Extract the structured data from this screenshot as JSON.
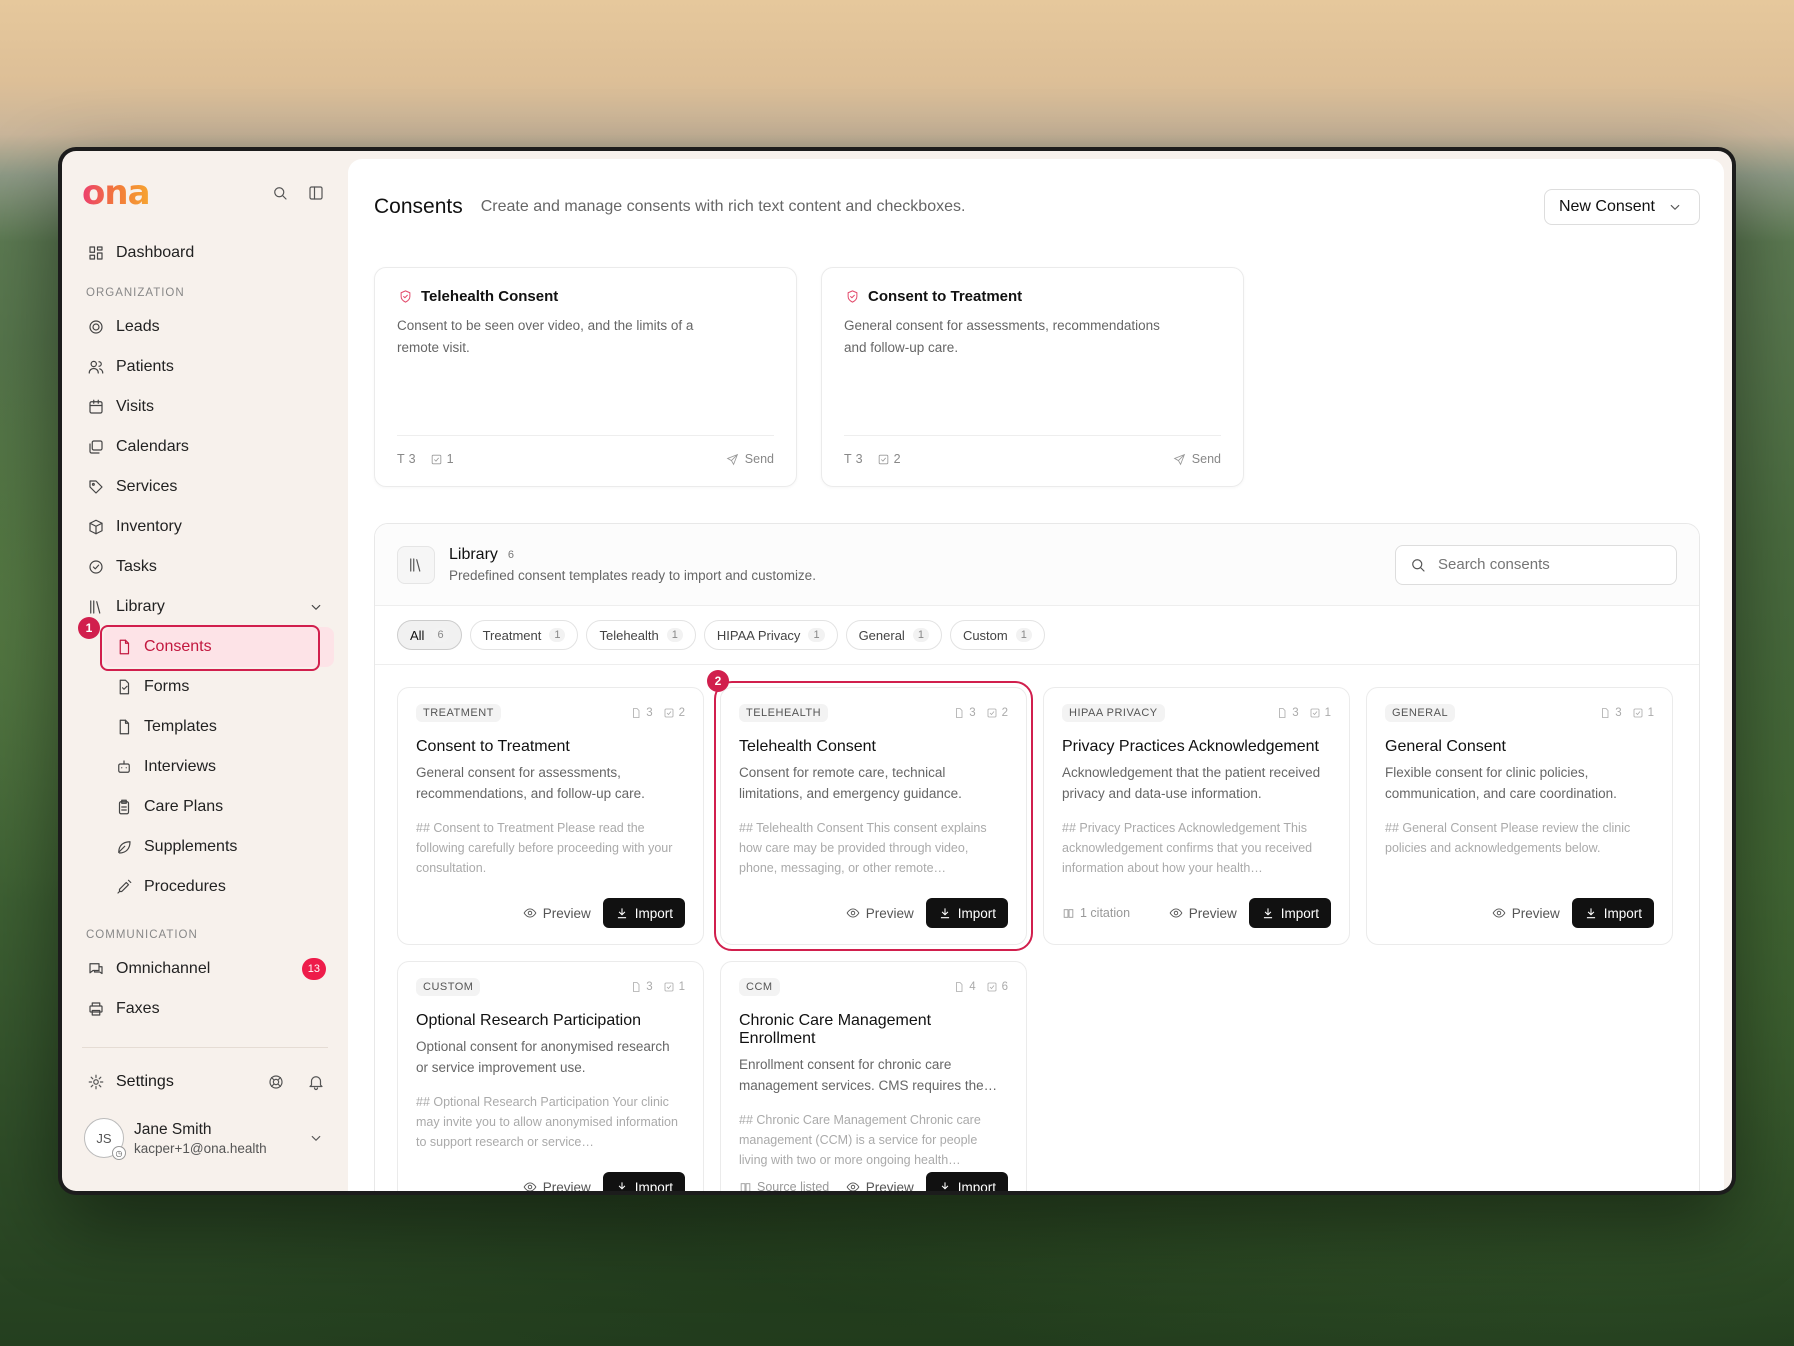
{
  "sidebar": {
    "logo": "ona",
    "dashboard": "Dashboard",
    "org_label": "ORGANIZATION",
    "org_items": [
      "Leads",
      "Patients",
      "Visits",
      "Calendars",
      "Services",
      "Inventory",
      "Tasks"
    ],
    "library": "Library",
    "library_items": [
      "Consents",
      "Forms",
      "Templates",
      "Interviews",
      "Care Plans",
      "Supplements",
      "Procedures"
    ],
    "comm_label": "COMMUNICATION",
    "omnichannel": "Omnichannel",
    "omnichannel_badge": "13",
    "faxes": "Faxes",
    "settings": "Settings",
    "user": {
      "initials": "JS",
      "name": "Jane Smith",
      "email": "kacper+1@ona.health"
    },
    "step1": "1"
  },
  "header": {
    "title": "Consents",
    "description": "Create and manage consents with rich text content and checkboxes.",
    "new_button": "New Consent"
  },
  "top_cards": [
    {
      "title": "Telehealth Consent",
      "body": "Consent to be seen over video, and the limits of a remote visit.",
      "fields": "3",
      "checks": "1",
      "send": "Send"
    },
    {
      "title": "Consent to Treatment",
      "body": "General consent for assessments, recommendations and follow-up care.",
      "fields": "3",
      "checks": "2",
      "send": "Send"
    }
  ],
  "library": {
    "title": "Library",
    "count": "6",
    "subtitle": "Predefined consent templates ready to import and customize.",
    "search_placeholder": "Search consents",
    "filters": [
      {
        "label": "All",
        "count": "6"
      },
      {
        "label": "Treatment",
        "count": "1"
      },
      {
        "label": "Telehealth",
        "count": "1"
      },
      {
        "label": "HIPAA Privacy",
        "count": "1"
      },
      {
        "label": "General",
        "count": "1"
      },
      {
        "label": "Custom",
        "count": "1"
      }
    ],
    "step2": "2",
    "preview_label": "Preview",
    "import_label": "Import",
    "cards": [
      {
        "tag": "TREATMENT",
        "docs": "3",
        "checks": "2",
        "title": "Consent to Treatment",
        "desc": "General consent for assessments, recommendations, and follow-up care.",
        "md": "## Consent to Treatment Please read the following carefully before proceeding with your consultation.",
        "cite": ""
      },
      {
        "tag": "TELEHEALTH",
        "docs": "3",
        "checks": "2",
        "title": "Telehealth Consent",
        "desc": "Consent for remote care, technical limitations, and emergency guidance.",
        "md": "## Telehealth Consent This consent explains how care may be provided through video, phone, messaging, or other remote…",
        "cite": ""
      },
      {
        "tag": "HIPAA PRIVACY",
        "docs": "3",
        "checks": "1",
        "title": "Privacy Practices Acknowledgement",
        "desc": "Acknowledgement that the patient received privacy and data-use information.",
        "md": "## Privacy Practices Acknowledgement This acknowledgement confirms that you received information about how your health…",
        "cite": "1 citation"
      },
      {
        "tag": "GENERAL",
        "docs": "3",
        "checks": "1",
        "title": "General Consent",
        "desc": "Flexible consent for clinic policies, communication, and care coordination.",
        "md": "## General Consent Please review the clinic policies and acknowledgements below.",
        "cite": ""
      },
      {
        "tag": "CUSTOM",
        "docs": "3",
        "checks": "1",
        "title": "Optional Research Participation",
        "desc": "Optional consent for anonymised research or service improvement use.",
        "md": "## Optional Research Participation Your clinic may invite you to allow anonymised information to support research or service…",
        "cite": ""
      },
      {
        "tag": "CCM",
        "docs": "4",
        "checks": "6",
        "title": "Chronic Care Management Enrollment",
        "desc": "Enrollment consent for chronic care management services. CMS requires the…",
        "md": "## Chronic Care Management Chronic care management (CCM) is a service for people living with two or more ongoing health…",
        "cite": "Source listed"
      }
    ]
  },
  "chat": {
    "badge": "13"
  },
  "colors": {
    "accent": "#d11f4d",
    "active_bg": "#fde3e7",
    "badge": "#ee1c4a"
  }
}
